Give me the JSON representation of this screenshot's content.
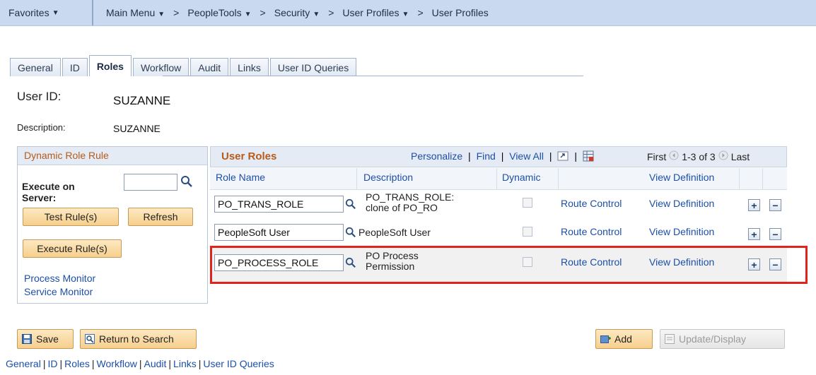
{
  "breadcrumb": {
    "favorites": "Favorites",
    "main_menu": "Main Menu",
    "items": [
      "PeopleTools",
      "Security",
      "User Profiles",
      "User Profiles"
    ]
  },
  "tabs": [
    "General",
    "ID",
    "Roles",
    "Workflow",
    "Audit",
    "Links",
    "User ID Queries"
  ],
  "active_tab": "Roles",
  "user": {
    "user_id_label": "User ID:",
    "user_id": "SUZANNE",
    "description_label": "Description:",
    "description": "SUZANNE"
  },
  "dynamic_role_rule": {
    "title": "Dynamic Role Rule",
    "execute_label": "Execute on Server:",
    "execute_value": "",
    "test_rules": "Test Rule(s)",
    "refresh": "Refresh",
    "execute_rules": "Execute Rule(s)",
    "process_monitor": "Process Monitor",
    "service_monitor": "Service Monitor"
  },
  "user_roles": {
    "title": "User Roles",
    "personalize": "Personalize",
    "find": "Find",
    "view_all": "View All",
    "first": "First",
    "range": "1-3 of 3",
    "last": "Last",
    "columns": [
      "Role Name",
      "Description",
      "Dynamic",
      "View Definition"
    ],
    "rows": [
      {
        "role": "PO_TRANS_ROLE",
        "desc1": "PO_TRANS_ROLE:",
        "desc2": "clone of PO_RO",
        "route": "Route Control",
        "view": "View Definition"
      },
      {
        "role": "PeopleSoft User",
        "desc1": "PeopleSoft User",
        "desc2": "",
        "route": "Route Control",
        "view": "View Definition"
      },
      {
        "role": "PO_PROCESS_ROLE",
        "desc1": "PO Process",
        "desc2": "Permission",
        "route": "Route Control",
        "view": "View Definition"
      }
    ]
  },
  "buttons": {
    "save": "Save",
    "return_to_search": "Return to Search",
    "add": "Add",
    "update_display": "Update/Display"
  },
  "bottom_links": [
    "General",
    "ID",
    "Roles",
    "Workflow",
    "Audit",
    "Links",
    "User ID Queries"
  ],
  "colors": {
    "highlight": "#e0241b",
    "link": "#1c4fa8",
    "header_bg": "#c9daf0"
  }
}
